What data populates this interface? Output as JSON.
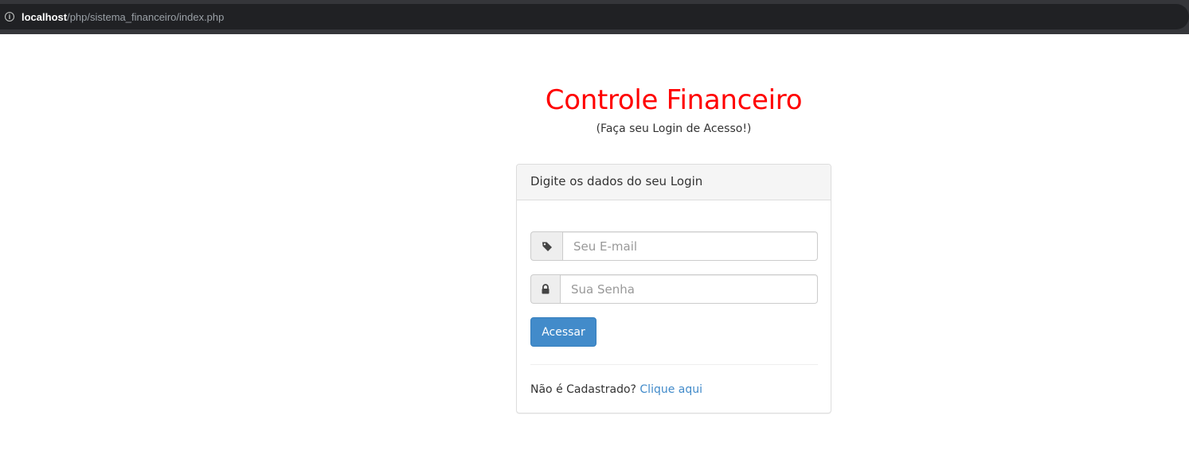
{
  "browser": {
    "url_host": "localhost",
    "url_path": "/php/sistema_financeiro/index.php",
    "info_icon": "info-icon"
  },
  "page": {
    "title": "Controle Financeiro",
    "subtitle": "(Faça seu Login de Acesso!)",
    "title_color": "#ff0000"
  },
  "login_panel": {
    "heading": "Digite os dados do seu Login",
    "email": {
      "icon": "tag-icon",
      "placeholder": "Seu E-mail",
      "value": ""
    },
    "password": {
      "icon": "lock-icon",
      "placeholder": "Sua Senha",
      "value": ""
    },
    "submit_label": "Acessar",
    "submit_color": "#428bca",
    "register_text": "Não é Cadastrado?",
    "register_link": "Clique aqui"
  }
}
